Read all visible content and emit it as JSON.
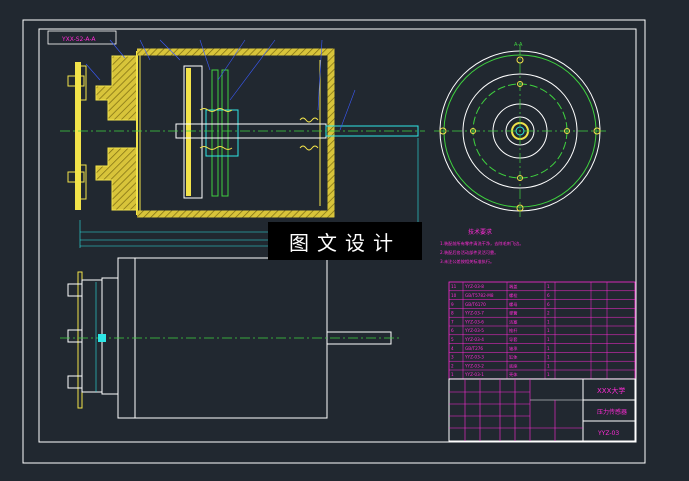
{
  "drawing": {
    "top_label": "YXX-S2-A-A",
    "section_label": "A-A",
    "title_code": "YYZ-03",
    "title_name": "压力传感器",
    "school": "XXX大学",
    "tech_requirements_title": "技术要求",
    "tech_requirements": [
      "1.装配前所有零件清洗干净，去除毛刺飞边。",
      "2.装配后各活动部件灵活可靠。",
      "3.未注公差按相关标准执行。"
    ],
    "watermark": "图文设计",
    "parts_rows": [
      [
        "11",
        "YYZ-03-8",
        "端盖",
        "1",
        "",
        "",
        ""
      ],
      [
        "10",
        "GB/T5782-M8",
        "螺栓",
        "6",
        "",
        "",
        ""
      ],
      [
        "9",
        "GB/T6170",
        "螺母",
        "6",
        "",
        "",
        ""
      ],
      [
        "8",
        "YYZ-03-7",
        "弹簧",
        "2",
        "",
        "",
        ""
      ],
      [
        "7",
        "YYZ-03-6",
        "活塞",
        "1",
        "",
        "",
        ""
      ],
      [
        "6",
        "YYZ-03-5",
        "推杆",
        "1",
        "",
        "",
        ""
      ],
      [
        "5",
        "YYZ-03-4",
        "导套",
        "1",
        "",
        "",
        ""
      ],
      [
        "4",
        "GB/T276",
        "轴承",
        "1",
        "",
        "",
        ""
      ],
      [
        "3",
        "YYZ-03-3",
        "缸体",
        "1",
        "",
        "",
        ""
      ],
      [
        "2",
        "YYZ-03-2",
        "底座",
        "1",
        "",
        "",
        ""
      ],
      [
        "1",
        "YYZ-03-1",
        "壳体",
        "1",
        "",
        "",
        ""
      ]
    ],
    "colors": {
      "frame": "#ffffff",
      "yellow": "#f2e34a",
      "green": "#3fd13f",
      "magenta": "#ff2bd6",
      "cyan": "#2ee6e6",
      "blue": "#3b5bff"
    }
  }
}
